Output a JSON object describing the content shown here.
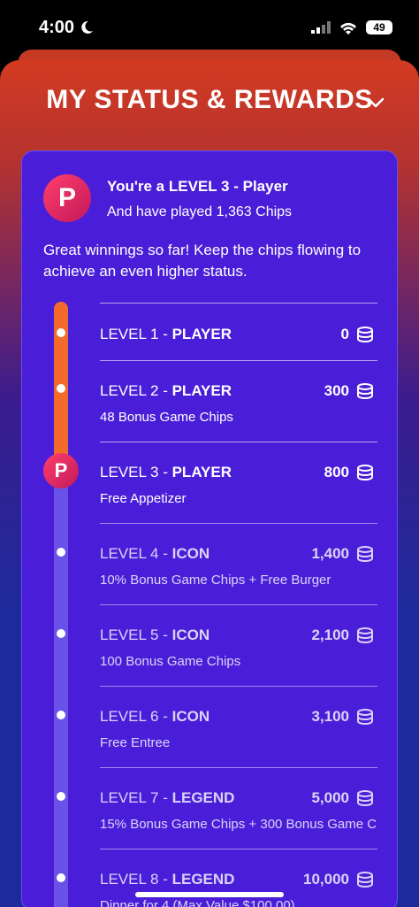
{
  "status_bar": {
    "time": "4:00",
    "battery": "49"
  },
  "header": {
    "title": "MY STATUS & REWARDS"
  },
  "summary": {
    "avatar_letter": "P",
    "headline": "You're a LEVEL 3 - Player",
    "played": "And have played 1,363 Chips",
    "message": "Great winnings so far! Keep the chips flowing to achieve an even higher status."
  },
  "levels": [
    {
      "prefix": "LEVEL 1 - ",
      "tier": "PLAYER",
      "chips": "0",
      "reward": ""
    },
    {
      "prefix": "LEVEL 2 - ",
      "tier": "PLAYER",
      "chips": "300",
      "reward": "48 Bonus Game Chips"
    },
    {
      "prefix": "LEVEL 3 - ",
      "tier": "PLAYER",
      "chips": "800",
      "reward": "Free Appetizer"
    },
    {
      "prefix": "LEVEL 4 - ",
      "tier": "ICON",
      "chips": "1,400",
      "reward": "10% Bonus Game Chips + Free Burger"
    },
    {
      "prefix": "LEVEL 5 - ",
      "tier": "ICON",
      "chips": "2,100",
      "reward": "100 Bonus Game Chips"
    },
    {
      "prefix": "LEVEL 6 - ",
      "tier": "ICON",
      "chips": "3,100",
      "reward": "Free Entree"
    },
    {
      "prefix": "LEVEL 7 - ",
      "tier": "LEGEND",
      "chips": "5,000",
      "reward": "15% Bonus Game Chips + 300 Bonus Game C"
    },
    {
      "prefix": "LEVEL 8 - ",
      "tier": "LEGEND",
      "chips": "10,000",
      "reward": "Dinner for 4 (Max Value $100.00)"
    }
  ],
  "colors": {
    "progress": "#f26b2b",
    "track": "#6a52e8",
    "card": "#4a1ed8"
  }
}
